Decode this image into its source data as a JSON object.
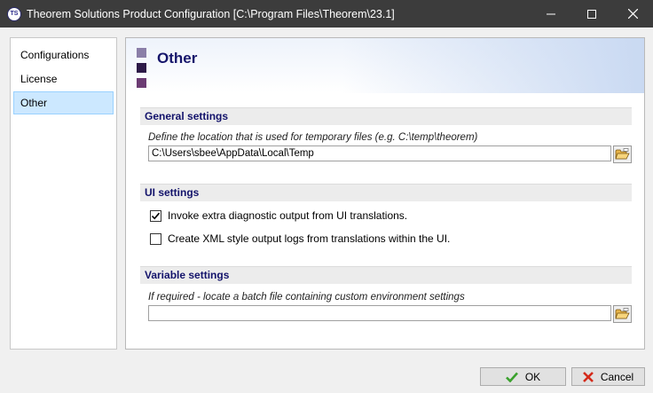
{
  "window": {
    "app_icon": "TS",
    "title": "Theorem Solutions Product Configuration [C:\\Program Files\\Theorem\\23.1]",
    "controls": [
      "minimize-icon",
      "maximize-icon",
      "close-icon"
    ]
  },
  "sidebar": {
    "items": [
      {
        "label": "Configurations",
        "selected": false
      },
      {
        "label": "License",
        "selected": false
      },
      {
        "label": "Other",
        "selected": true
      }
    ]
  },
  "main": {
    "title": "Other",
    "general": {
      "header": "General settings",
      "hint": "Define the location that is used for temporary files (e.g. C:\\temp\\theorem)",
      "path_value": "C:\\Users\\sbee\\AppData\\Local\\Temp",
      "browse_icon": "folder-open-icon"
    },
    "ui": {
      "header": "UI settings",
      "options": [
        {
          "label": "Invoke extra diagnostic output from UI translations.",
          "checked": true
        },
        {
          "label": "Create XML style output logs from translations within the UI.",
          "checked": false
        }
      ]
    },
    "variable": {
      "header": "Variable settings",
      "hint": "If required - locate a batch file containing custom environment settings",
      "path_value": "",
      "browse_icon": "folder-open-icon"
    }
  },
  "footer": {
    "ok_label": "OK",
    "cancel_label": "Cancel"
  },
  "colors": {
    "titlebar": "#3c3c3c",
    "section_header_text": "#13136b",
    "page_title_text": "#16166b",
    "selected_item_bg": "#cce8ff",
    "ok_check": "#3aa12d",
    "cancel_x": "#d42a1a"
  }
}
